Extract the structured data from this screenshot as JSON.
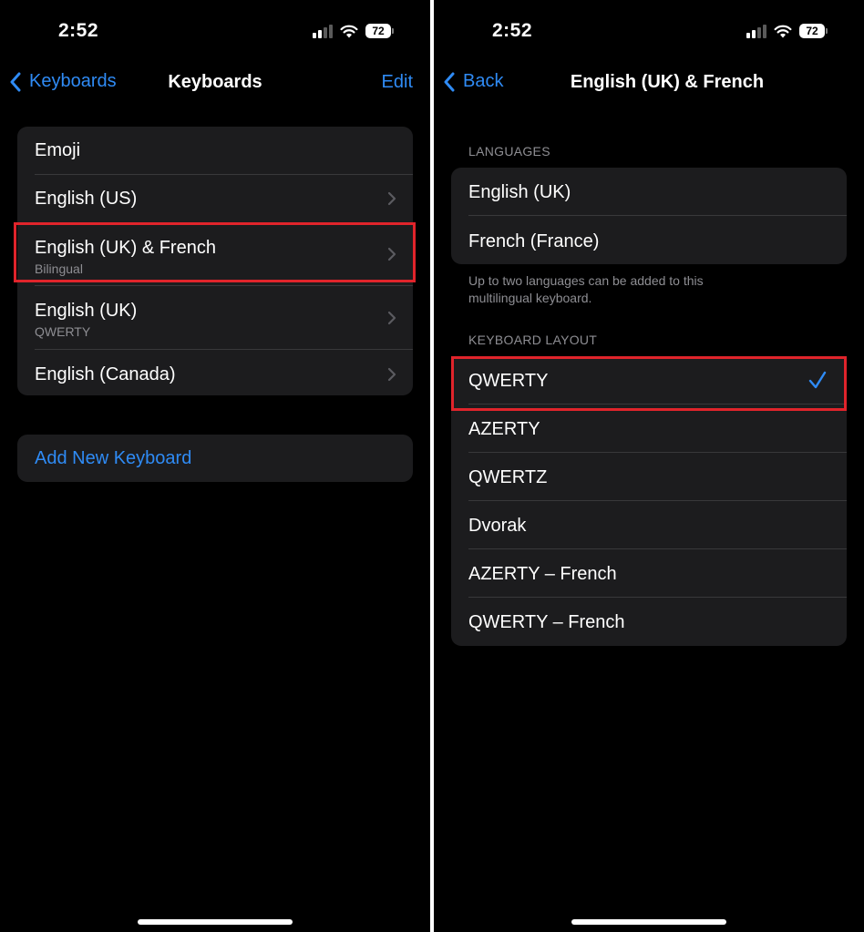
{
  "left": {
    "status": {
      "time": "2:52",
      "battery": "72"
    },
    "nav": {
      "back_label": "Keyboards",
      "title": "Keyboards",
      "edit_label": "Edit"
    },
    "keyboards": [
      {
        "label": "Emoji",
        "sub": ""
      },
      {
        "label": "English (US)",
        "sub": ""
      },
      {
        "label": "English (UK) & French",
        "sub": "Bilingual"
      },
      {
        "label": "English (UK)",
        "sub": "QWERTY"
      },
      {
        "label": "English (Canada)",
        "sub": ""
      }
    ],
    "add_keyboard_label": "Add New Keyboard"
  },
  "right": {
    "status": {
      "time": "2:52",
      "battery": "72"
    },
    "nav": {
      "back_label": "Back",
      "title": "English (UK) & French"
    },
    "languages_header": "LANGUAGES",
    "languages": [
      "English (UK)",
      "French (France)"
    ],
    "languages_footer": "Up to two languages can be added to this multilingual keyboard.",
    "layout_header": "KEYBOARD LAYOUT",
    "layouts": [
      "QWERTY",
      "AZERTY",
      "QWERTZ",
      "Dvorak",
      "AZERTY – French",
      "QWERTY – French"
    ],
    "selected_layout": "QWERTY"
  },
  "colors": {
    "accent": "#2f8bf5",
    "highlight": "#e0242b",
    "cell": "#1c1c1e",
    "background": "#000000"
  }
}
